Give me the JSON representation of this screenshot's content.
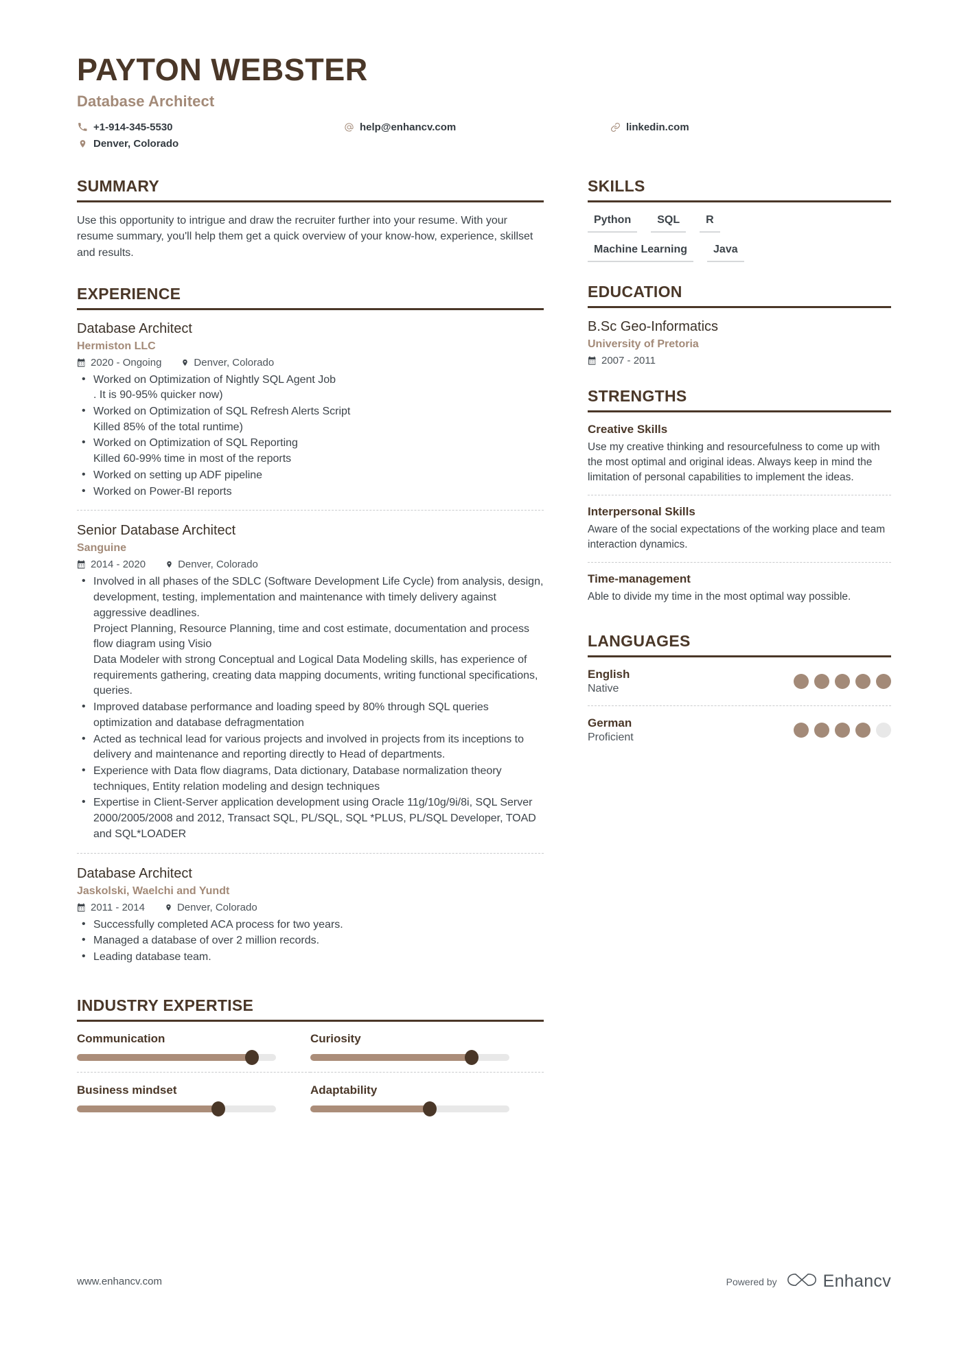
{
  "header": {
    "name": "PAYTON WEBSTER",
    "job_title": "Database Architect",
    "contacts": [
      {
        "icon": "phone-icon",
        "text": "+1-914-345-5530"
      },
      {
        "icon": "location-pin-icon",
        "text": "Denver, Colorado"
      },
      {
        "icon": "at-sign-icon",
        "text": "help@enhancv.com"
      },
      {
        "icon": "link-icon",
        "text": "linkedin.com"
      }
    ]
  },
  "summary": {
    "heading": "SUMMARY",
    "text": "Use this opportunity to intrigue and draw the recruiter further into your resume. With your resume summary, you'll help them get a quick overview of your know-how, experience, skillset and results."
  },
  "experience": {
    "heading": "EXPERIENCE",
    "entries": [
      {
        "role": "Database Architect",
        "company": "Hermiston LLC",
        "dates": "2020 - Ongoing",
        "location": "Denver, Colorado",
        "bullets": [
          {
            "line1": "Worked on Optimization of Nightly SQL Agent Job",
            "line2": ". It is 90-95% quicker now)"
          },
          {
            "line1": "Worked on Optimization of SQL Refresh Alerts Script",
            "line2": "Killed 85% of the total runtime)"
          },
          {
            "line1": "Worked on Optimization of SQL Reporting",
            "line2": "Killed 60-99% time in most of the reports"
          },
          {
            "line1": "Worked on setting up ADF pipeline",
            "line2": ""
          },
          {
            "line1": "Worked on Power-BI reports",
            "line2": ""
          }
        ]
      },
      {
        "role": "Senior Database Architect",
        "company": "Sanguine",
        "dates": "2014 - 2020",
        "location": "Denver, Colorado",
        "bullets": [
          {
            "line1": "Involved in all phases of the SDLC (Software Development Life Cycle) from analysis, design, development, testing, implementation and maintenance with timely delivery against aggressive deadlines.",
            "line2": "Project Planning, Resource Planning, time and cost estimate, documentation and process flow diagram using Visio",
            "line3": "Data Modeler with strong Conceptual and Logical Data Modeling skills, has experience of requirements gathering, creating data mapping documents, writing functional specifications, queries."
          },
          {
            "line1": "Improved database performance and loading speed by 80% through SQL queries optimization and database defragmentation",
            "line2": ""
          },
          {
            "line1": "Acted as technical lead for various projects and involved in projects from its inceptions to delivery and maintenance and reporting directly to Head of departments.",
            "line2": ""
          },
          {
            "line1": "Experience with Data flow diagrams, Data dictionary, Database normalization theory techniques, Entity relation modeling and design techniques",
            "line2": ""
          },
          {
            "line1": "Expertise in Client-Server application development using Oracle 11g/10g/9i/8i, SQL Server 2000/2005/2008 and 2012, Transact SQL, PL/SQL, SQL *PLUS, PL/SQL Developer, TOAD and SQL*LOADER",
            "line2": ""
          }
        ]
      },
      {
        "role": "Database Architect",
        "company": "Jaskolski, Waelchi and Yundt",
        "dates": "2011 - 2014",
        "location": "Denver, Colorado",
        "bullets": [
          {
            "line1": "Successfully completed ACA process for two years.",
            "line2": ""
          },
          {
            "line1": "Managed a database of over 2 million records.",
            "line2": ""
          },
          {
            "line1": "Leading database team.",
            "line2": ""
          }
        ]
      }
    ]
  },
  "skills": {
    "heading": "SKILLS",
    "rows": [
      [
        "Python",
        "SQL",
        "R"
      ],
      [
        "Machine Learning",
        "Java"
      ]
    ]
  },
  "education": {
    "heading": "EDUCATION",
    "entries": [
      {
        "degree": "B.Sc Geo-Informatics",
        "school": "University of Pretoria",
        "dates": "2007 - 2011"
      }
    ]
  },
  "strengths": {
    "heading": "STRENGTHS",
    "entries": [
      {
        "title": "Creative Skills",
        "text": "Use my creative thinking and resourcefulness to come up with the most optimal and original ideas. Always keep in mind the limitation of personal capabilities to implement the ideas."
      },
      {
        "title": "Interpersonal Skills",
        "text": "Aware of the social expectations of the working place and team interaction dynamics."
      },
      {
        "title": "Time-management",
        "text": "Able to divide my time in the most optimal way possible."
      }
    ]
  },
  "languages": {
    "heading": "LANGUAGES",
    "entries": [
      {
        "name": "English",
        "level": "Native",
        "filled": 5,
        "total": 5
      },
      {
        "name": "German",
        "level": "Proficient",
        "filled": 4,
        "total": 5
      }
    ]
  },
  "industry_expertise": {
    "heading": "INDUSTRY EXPERTISE",
    "items": [
      {
        "label": "Communication",
        "value": 88
      },
      {
        "label": "Curiosity",
        "value": 81
      },
      {
        "label": "Business mindset",
        "value": 71
      },
      {
        "label": "Adaptability",
        "value": 60
      }
    ]
  },
  "footer": {
    "url": "www.enhancv.com",
    "powered_by": "Powered by",
    "brand": "Enhancv"
  },
  "colors": {
    "primary_dark_brown": "#4a3728",
    "accent_tan": "#a38a78",
    "body_text": "#3c4349",
    "slider_fill": "#ab8d79",
    "muted_gray": "#e8e8e8"
  }
}
